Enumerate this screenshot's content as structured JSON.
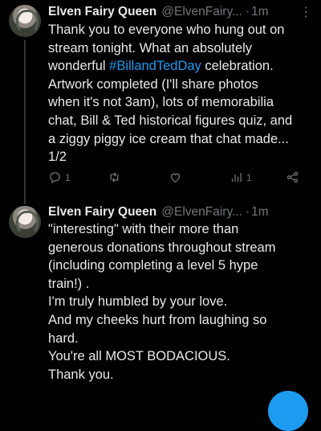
{
  "tweets": [
    {
      "name": "Elven Fairy Queen",
      "handle": "@ElvenFairy...",
      "sep": "·",
      "time": "1m",
      "more": "⋮",
      "lines": [
        "Thank you to everyone who hung out on",
        "stream tonight. What an absolutely",
        "",
        "Artwork completed (I'll share photos",
        "when it's not 3am), lots of memorabilia",
        "chat, Bill & Ted historical figures quiz, and",
        "a ziggy piggy ice cream that chat made...",
        "1/2"
      ],
      "line3_pre": "wonderful ",
      "hashtag": "#BillandTedDay",
      "line3_post": " celebration.",
      "actions": {
        "reply_count": "1",
        "retweet_count": "",
        "like_count": "",
        "views_count": "1"
      }
    },
    {
      "name": "Elven Fairy Queen",
      "handle": "@ElvenFairy...",
      "sep": "·",
      "time": "1m",
      "lines": [
        "\"interesting\" with their more than",
        "generous donations throughout stream",
        "(including completing a level 5 hype",
        "train!) .",
        "I'm truly humbled by your love.",
        "And my cheeks hurt from laughing so",
        "hard.",
        "You're all MOST BODACIOUS.",
        "Thank you."
      ]
    }
  ],
  "colors": {
    "background": "#000000",
    "text": "#e7e9ea",
    "secondary": "#71767b",
    "accent": "#1d9bf0"
  },
  "icons": [
    "reply-icon",
    "retweet-icon",
    "like-icon",
    "views-icon",
    "share-icon",
    "more-icon",
    "compose-fab"
  ]
}
